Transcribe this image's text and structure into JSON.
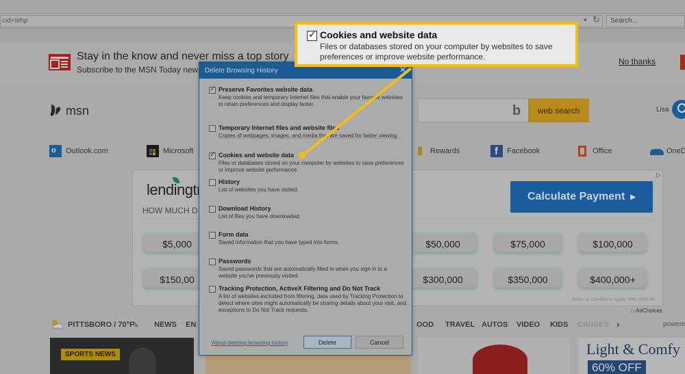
{
  "browser": {
    "address_fragment": "cid=iehp",
    "search_placeholder": "Search..."
  },
  "banner": {
    "title": "Stay in the know and never miss a top story",
    "subtitle": "Subscribe to the MSN Today newsletter",
    "no_thanks": "No thanks",
    "icon": "newspaper-icon"
  },
  "msn": {
    "logo_text": "msn",
    "search_button": "web search",
    "user_name": "Lisa"
  },
  "quicklinks": [
    {
      "label": "Outlook.com",
      "icon": "outlook-icon"
    },
    {
      "label": "Microsoft",
      "icon": "microsoft-store-icon"
    },
    {
      "label": "Rewards",
      "icon": "rewards-icon"
    },
    {
      "label": "Facebook",
      "icon": "facebook-icon"
    },
    {
      "label": "Office",
      "icon": "office-icon"
    },
    {
      "label": "OneD",
      "icon": "onedrive-icon"
    }
  ],
  "ad": {
    "brand": "lendingtr",
    "question": "HOW MUCH D",
    "cta": "Calculate Payment",
    "amounts_row1": [
      "$5,000",
      "$50,000",
      "$75,000",
      "$100,000"
    ],
    "amounts_row2": [
      "$150,00",
      "$300,000",
      "$350,000",
      "$400,000+"
    ],
    "terms": "Terms & Conditions apply. NMLS#1136",
    "adchoices": "AdChoices"
  },
  "newsnav": {
    "weather": "PITTSBORO / 70°F",
    "items": [
      "NEWS",
      "EN",
      "OOD",
      "TRAVEL",
      "AUTOS",
      "VIDEO",
      "KIDS",
      "CAUSES"
    ],
    "powered": "powered"
  },
  "cards": {
    "sports_tag": "SPORTS NEWS",
    "promo_title": "Light & Comfy",
    "promo_tag": "60% OFF"
  },
  "dialog": {
    "title": "Delete Browsing History",
    "options": [
      {
        "label": "Preserve Favorites website data",
        "desc": "Keep cookies and temporary Internet files that enable your favorite websites to retain preferences and display faster.",
        "checked": true
      },
      {
        "label": "Temporary Internet files and website files",
        "desc": "Copies of webpages, images, and media that are saved for faster viewing.",
        "checked": false
      },
      {
        "label": "Cookies and website data",
        "desc": "Files or databases stored on your computer by websites to save preferences or improve website performance.",
        "checked": true
      },
      {
        "label": "History",
        "desc": "List of websites you have visited.",
        "checked": false
      },
      {
        "label": "Download History",
        "desc": "List of files you have downloaded.",
        "checked": false
      },
      {
        "label": "Form data",
        "desc": "Saved information that you have typed into forms.",
        "checked": false
      },
      {
        "label": "Passwords",
        "desc": "Saved passwords that are automatically filled in when you sign in to a website you've previously visited.",
        "checked": false
      },
      {
        "label": "Tracking Protection, ActiveX Filtering and Do Not Track",
        "desc": "A list of websites excluded from filtering, data used by Tracking Protection to detect where sites might automatically be sharing details about your visit, and exceptions to Do Not Track requests.",
        "checked": false
      }
    ],
    "help_link": "About deleting browsing history",
    "delete_label": "Delete",
    "cancel_label": "Cancel"
  },
  "callout": {
    "title": "Cookies and website data",
    "desc": "Files or databases stored on your computer by websites to save preferences or improve website performance.",
    "checked": true,
    "accent": "#f0be1a"
  }
}
